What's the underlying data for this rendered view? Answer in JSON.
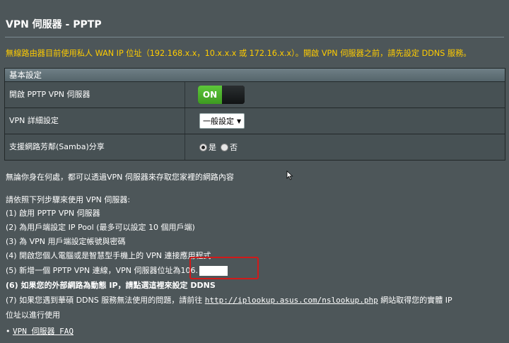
{
  "page": {
    "title": "VPN 伺服器 - PPTP",
    "warning": "無線路由器目前使用私人 WAN IP 位址（192.168.x.x，10.x.x.x 或 172.16.x.x）。開啟 VPN 伺服器之前，請先設定 DDNS 服務。"
  },
  "panel": {
    "header": "基本設定",
    "rows": [
      {
        "label": "開啟 PPTP VPN 伺服器",
        "toggle": "ON"
      },
      {
        "label": "VPN 詳細設定",
        "select": "一般設定"
      },
      {
        "label": "支援網路芳鄰(Samba)分享",
        "radio_yes": "是",
        "radio_no": "否",
        "selected": "是"
      }
    ]
  },
  "content": {
    "intro": "無論你身在何處，都可以透過VPN 伺服器來存取您家裡的網路內容",
    "steps_title": "請依照下列步驟來使用 VPN 伺服器:",
    "step1": "(1) 啟用 PPTP VPN 伺服器",
    "step2": "(2) 為用戶端設定 IP Pool (最多可以設定 10 個用戶端)",
    "step3": "(3) 為 VPN 用戶端設定帳號與密碼",
    "step4": "(4) 開啟您個人電腦或是智慧型手機上的 VPN 連接應用程式",
    "step5": "(5) 新增一個 PPTP VPN 連線，VPN 伺服器位址為106.",
    "step6": "(6) 如果您的外部網路為動態 IP，請點選這裡來設定  DDNS",
    "step7_prefix": "(7) 如果您遇到華碩 DDNS 服務無法使用的問題，請前往",
    "step7_link": "http://iplookup.asus.com/nslookup.php",
    "step7_suffix": "網站取得您的實體 IP",
    "step7_cont": "位址以進行使用",
    "faq": "VPN 伺服器 FAQ"
  },
  "colors": {
    "background": "#4d5659",
    "warning": "#ffcc00",
    "toggle_on": "#4aaa2a",
    "highlight": "#d11a1a"
  }
}
